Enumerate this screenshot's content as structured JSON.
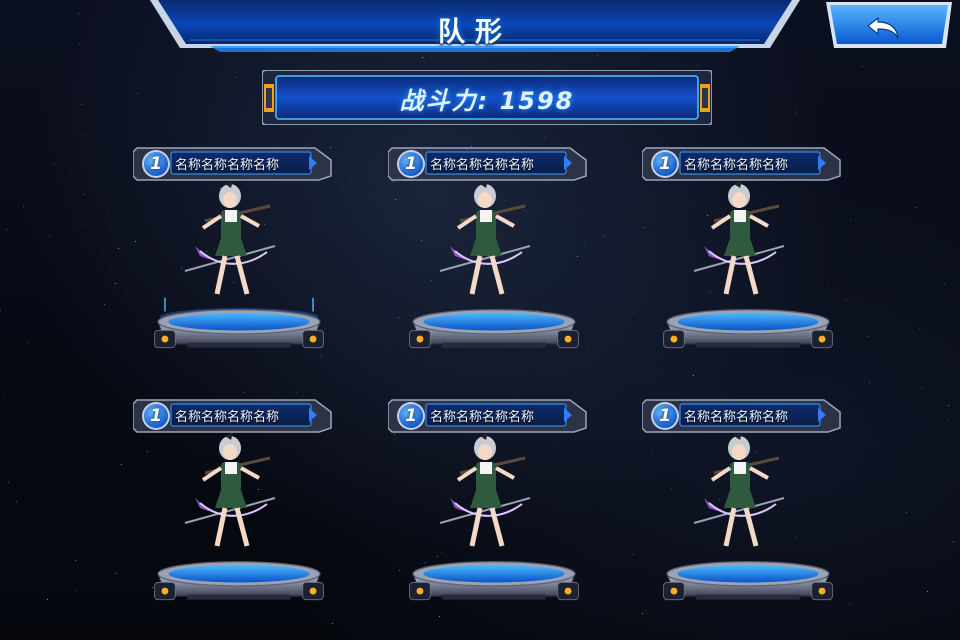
{
  "header": {
    "title": "队形"
  },
  "back_button": {
    "icon": "back-arrow-icon"
  },
  "power": {
    "text": "战斗力: 1598"
  },
  "slots": [
    {
      "level": "1",
      "name": "名称名称名称名称",
      "selected": true
    },
    {
      "level": "1",
      "name": "名称名称名称名称",
      "selected": false
    },
    {
      "level": "1",
      "name": "名称名称名称名称",
      "selected": false
    },
    {
      "level": "1",
      "name": "名称名称名称名称",
      "selected": false
    },
    {
      "level": "1",
      "name": "名称名称名称名称",
      "selected": false
    },
    {
      "level": "1",
      "name": "名称名称名称名称",
      "selected": false
    }
  ],
  "colors": {
    "accent": "#1e7bff",
    "frame": "#2a3a5a",
    "glow": "#4fc3ff",
    "badge": "#1f6fe0"
  }
}
